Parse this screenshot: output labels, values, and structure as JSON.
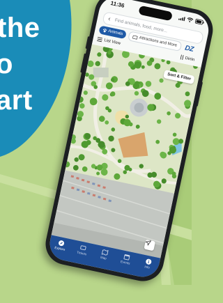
{
  "promo": {
    "line1": "the",
    "line2": "o",
    "line3": "art"
  },
  "colors": {
    "promo_bg": "#1a8cb8",
    "grass": "#b8d68a",
    "nav_blue": "#1f4e96",
    "chip_blue": "#1f5aa6"
  },
  "status": {
    "time": "11:36"
  },
  "search": {
    "placeholder": "Find animals, food, more..."
  },
  "categories": {
    "animals": "Animals",
    "attractions": "Attractions and More"
  },
  "brand": "DZ",
  "toolbar": {
    "list_view": "List View",
    "dining": "Dinin"
  },
  "map": {
    "sort_filter": "Sort & Filter"
  },
  "nav": {
    "items": [
      {
        "label": "Explore",
        "icon": "compass-icon"
      },
      {
        "label": "Tickets",
        "icon": "ticket-icon"
      },
      {
        "label": "Map",
        "icon": "map-icon"
      },
      {
        "label": "Events",
        "icon": "calendar-icon"
      },
      {
        "label": "Info",
        "icon": "info-icon"
      }
    ]
  }
}
